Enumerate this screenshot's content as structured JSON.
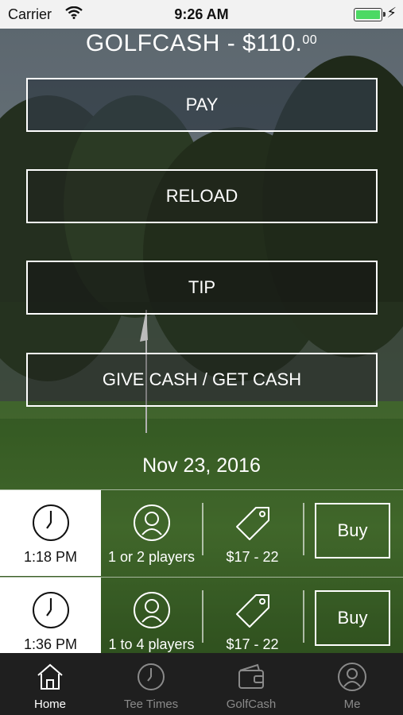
{
  "status_bar": {
    "carrier": "Carrier",
    "time": "9:26 AM"
  },
  "balance": {
    "label": "GOLFCASH - $110.",
    "cents": "00"
  },
  "actions": {
    "pay": "PAY",
    "reload": "RELOAD",
    "tip": "TIP",
    "give": "GIVE CASH / GET CASH"
  },
  "date": "Nov 23, 2016",
  "tee_times": [
    {
      "time": "1:18 PM",
      "players": "1 or 2 players",
      "price": "$17 - 22",
      "buy_label": "Buy"
    },
    {
      "time": "1:36 PM",
      "players": "1 to 4 players",
      "price": "$17 - 22",
      "buy_label": "Buy"
    }
  ],
  "tabs": [
    {
      "label": "Home",
      "icon": "home-icon",
      "active": true
    },
    {
      "label": "Tee Times",
      "icon": "clock-icon",
      "active": false
    },
    {
      "label": "GolfCash",
      "icon": "wallet-icon",
      "active": false
    },
    {
      "label": "Me",
      "icon": "user-icon",
      "active": false
    }
  ],
  "colors": {
    "battery": "#4cd964",
    "tabbar": "#1f1f1f",
    "text": "#ffffff"
  }
}
